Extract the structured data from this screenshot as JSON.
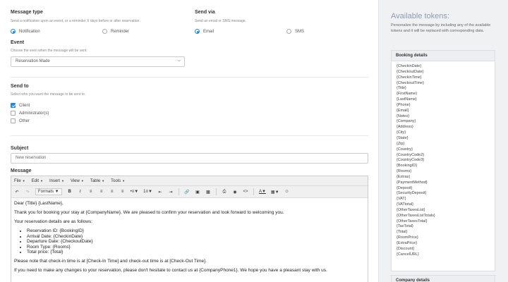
{
  "message_type": {
    "label": "Message type",
    "hint": "Send a notification upon an event, or a reminder X days before or after reservation.",
    "options": [
      "Notification",
      "Reminder"
    ],
    "selected": "Notification"
  },
  "send_via": {
    "label": "Send via",
    "hint": "Send an email or SMS message.",
    "options": [
      "Email",
      "SMS"
    ],
    "selected": "Email"
  },
  "event": {
    "label": "Event",
    "hint": "Choose the even when the message will be sent.",
    "value": "Reservation Made"
  },
  "send_to": {
    "label": "Send to",
    "hint": "Select who you want the message to be sent to.",
    "options": [
      {
        "label": "Client",
        "checked": true
      },
      {
        "label": "Administrator(s)",
        "checked": false
      },
      {
        "label": "Other",
        "checked": false
      }
    ]
  },
  "subject": {
    "label": "Subject",
    "value": "New reservation"
  },
  "message": {
    "label": "Message",
    "menus": [
      "File",
      "Edit",
      "Insert",
      "View",
      "Table",
      "Tools"
    ],
    "formats_label": "Formats",
    "greeting": "Dear {Title} {LastName},",
    "p1": "Thank you for booking your stay at {CompanyName}. We are pleased to confirm your reservation and look forward to welcoming you.",
    "p2": "Your reservation details are as follows:",
    "details": [
      "Reservation ID: {BookingID}",
      "Arrival Date: {CheckinDate}",
      "Departure Date: {CheckoutDate}",
      "Room Type: {Rooms}",
      "Total price: {Total}"
    ],
    "p3": "Please note that check-in time is at [Check-In Time] and check-out time is at [Check-Out Time].",
    "p4": "If you need to make any changes to your reservation, please don't hesitate to contact us at {CompanyPhone1}. We hope you have a pleasant stay with us."
  },
  "sidebar": {
    "title": "Available tokens:",
    "description": "Personalize the message by including any of the available tokens and it will be replaced with corresponding data.",
    "booking_panel_title": "Booking details",
    "company_panel_title": "Company details",
    "tokens": [
      "{CheckinDate}",
      "{CheckoutDate}",
      "{CheckinTime}",
      "{CheckoutTime}",
      "{Title}",
      "{FirstName}",
      "{LastName}",
      "{Phone}",
      "{Email}",
      "{Notes}",
      "{Company}",
      "{Address}",
      "{City}",
      "{State}",
      "{Zip}",
      "{Country}",
      "{CountryCode2}",
      "{CountryCode3}",
      "{BookingID}",
      "{Rooms}",
      "{Extras}",
      "{PaymentMethod}",
      "{Deposit}",
      "{SecurityDeposit}",
      "{VAT}",
      "{VATtotal}",
      "{OtherTaxesList}",
      "{OtherTaxesListTotals}",
      "{OtherTaxesTotal}",
      "{TaxTotal}",
      "{Total}",
      "{RoomPrice}",
      "{ExtraPrice}",
      "{Discount}",
      "{CancelURL}"
    ]
  },
  "colors": {
    "accent": "#1e88e5",
    "sidebar_title": "#8a9bb3"
  },
  "icons": [
    "undo-icon",
    "redo-icon",
    "bold-icon",
    "italic-icon",
    "align-left-icon",
    "align-center-icon",
    "align-right-icon",
    "align-justify-icon",
    "bullet-list-icon",
    "numbered-list-icon",
    "outdent-icon",
    "indent-icon",
    "link-icon",
    "image-icon",
    "media-icon",
    "print-icon",
    "preview-icon",
    "code-icon",
    "text-color-icon",
    "background-color-icon",
    "emoticons-icon"
  ]
}
